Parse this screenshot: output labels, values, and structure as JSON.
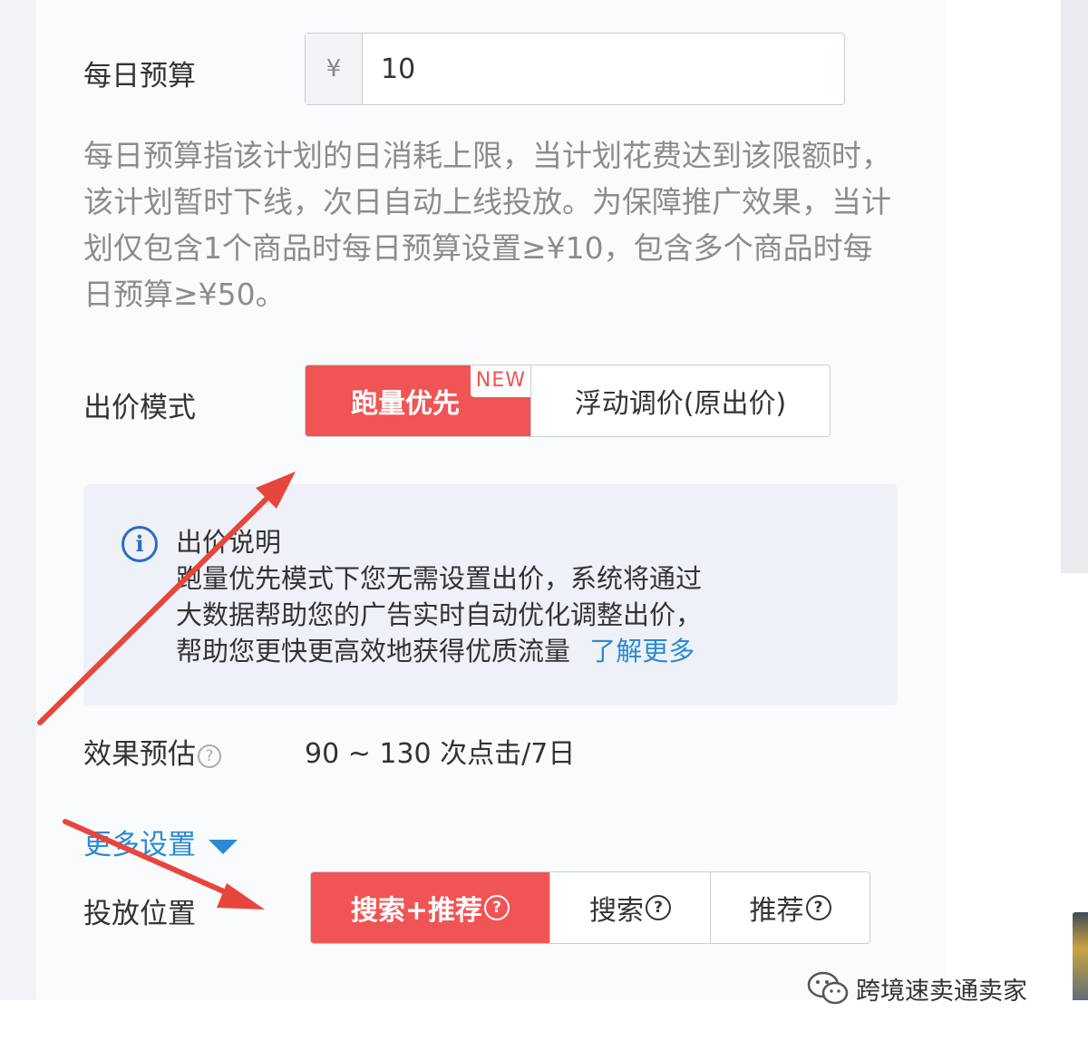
{
  "budget": {
    "label": "每日预算",
    "currency_symbol": "¥",
    "value": "10",
    "description": "每日预算指该计划的日消耗上限，当计划花费达到该限额时，该计划暂时下线，次日自动上线投放。为保障推广效果，当计划仅包含1个商品时每日预算设置≥¥10，包含多个商品时每日预算≥¥50。"
  },
  "bid_mode": {
    "label": "出价模式",
    "options": [
      {
        "label": "跑量优先",
        "badge": "NEW",
        "active": true
      },
      {
        "label": "浮动调价(原出价)",
        "active": false
      }
    ]
  },
  "bid_info": {
    "title": "出价说明",
    "lines": [
      "跑量优先模式下您无需设置出价，系统将通过",
      "大数据帮助您的广告实时自动优化调整出价，",
      "帮助您更快更高效地获得优质流量"
    ],
    "link": "了解更多"
  },
  "estimate": {
    "label": "效果预估",
    "value": "90 ~ 130 次点击/7日"
  },
  "more_settings": {
    "label": "更多设置"
  },
  "placement": {
    "label": "投放位置",
    "options": [
      {
        "label": "搜索+推荐",
        "active": true
      },
      {
        "label": "搜索",
        "active": false
      },
      {
        "label": "推荐",
        "active": false
      }
    ]
  },
  "watermark": {
    "text": "跨境速卖通卖家"
  },
  "colors": {
    "accent_red": "#f05454",
    "link_blue": "#2b8ad4",
    "info_blue": "#2b6cc4",
    "annotation_arrow": "#e8453c"
  },
  "icons": [
    "question-icon",
    "info-icon",
    "caret-down-icon",
    "wechat-icon"
  ]
}
